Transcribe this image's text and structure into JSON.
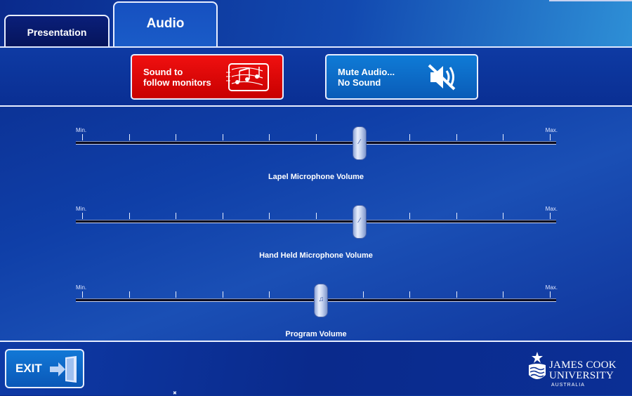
{
  "tabs": [
    {
      "label": "Presentation",
      "active": false
    },
    {
      "label": "Audio",
      "active": true
    }
  ],
  "buttons": {
    "sound": {
      "line1": "Sound to",
      "line2": "follow monitors",
      "color": "#e00808",
      "icon": "music-notes-icon"
    },
    "mute": {
      "line1": "Mute Audio...",
      "line2": "No Sound",
      "color": "#0a6cc8",
      "icon": "speaker-muted-icon"
    }
  },
  "sliders": [
    {
      "label": "Lapel Microphone Volume",
      "min_label": "Min.",
      "max_label": "Max.",
      "value_percent": 59,
      "icon": "microphone-icon"
    },
    {
      "label": "Hand Held Microphone Volume",
      "min_label": "Min.",
      "max_label": "Max.",
      "value_percent": 59,
      "icon": "microphone-icon"
    },
    {
      "label": "Program Volume",
      "min_label": "Min.",
      "max_label": "Max.",
      "value_percent": 51,
      "icon": "music-note-icon"
    }
  ],
  "exit": {
    "label": "EXIT",
    "icon": "exit-door-icon"
  },
  "logo": {
    "line1": "JAMES COOK",
    "line2": "UNIVERSITY",
    "line3": "AUSTRALIA",
    "icon": "jcu-crest-icon"
  },
  "colors": {
    "background": "#0f3fa8",
    "accent_red": "#e00808",
    "accent_blue": "#0a6cc8",
    "divider": "#e8eeff"
  }
}
